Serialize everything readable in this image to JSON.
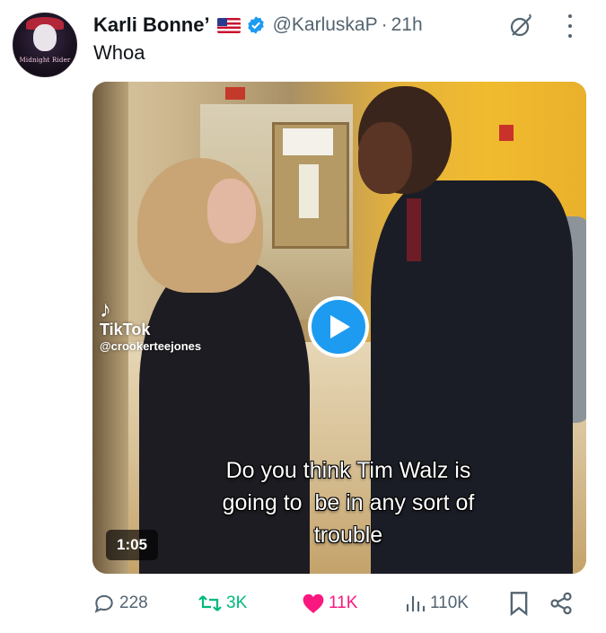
{
  "colors": {
    "accent": "#1d9bf0",
    "retweet": "#00ba7c",
    "like": "#f91880",
    "muted": "#536471"
  },
  "author": {
    "avatar_icon": "avatar-image",
    "avatar_label": "Midnight Rider",
    "display_name": "Karli Bonne’",
    "flag_icon": "us-flag-icon",
    "verified_icon": "verified-badge-icon",
    "handle": "@KarluskaP",
    "separator": "·",
    "time": "21h"
  },
  "tweet": {
    "text": "Whoa"
  },
  "video": {
    "watermark_brand": "TikTok",
    "watermark_user": "@crookerteejones",
    "caption_line1": "Do you think Tim Walz is",
    "caption_line2": "going to  be in any sort of",
    "caption_line3": "trouble",
    "duration": "1:05",
    "play_icon": "play-icon"
  },
  "actions": {
    "replies": "228",
    "reposts": "3K",
    "likes": "11K",
    "views": "110K"
  }
}
